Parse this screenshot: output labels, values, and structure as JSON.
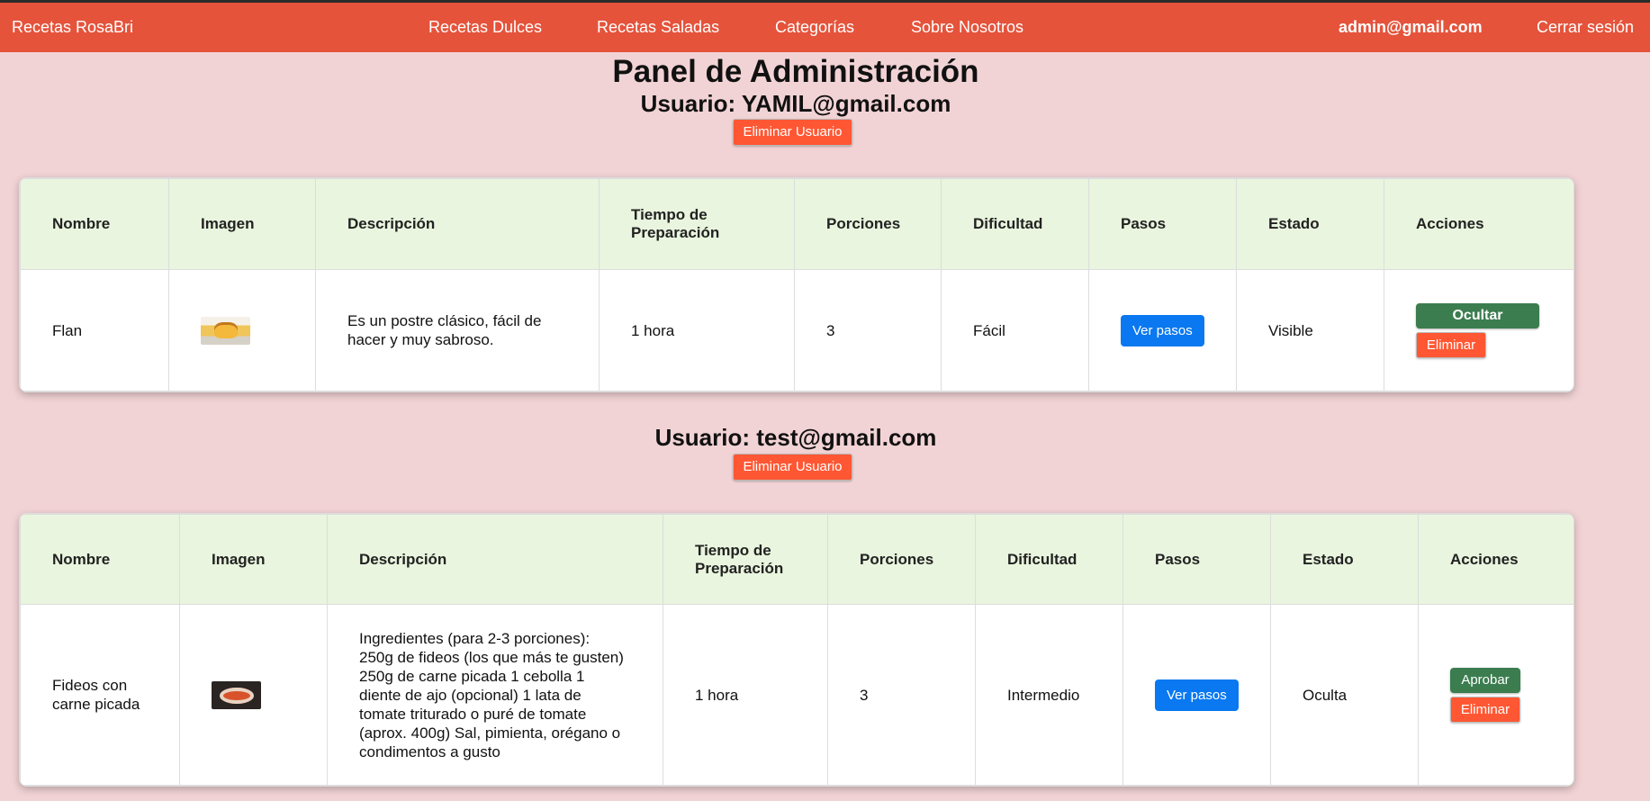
{
  "nav": {
    "brand": "Recetas RosaBri",
    "links": [
      "Recetas Dulces",
      "Recetas Saladas",
      "Categorías",
      "Sobre Nosotros"
    ],
    "user": "admin@gmail.com",
    "logout": "Cerrar sesión"
  },
  "page_title": "Panel de Administración",
  "headers": [
    "Nombre",
    "Imagen",
    "Descripción",
    "Tiempo de Preparación",
    "Porciones",
    "Dificultad",
    "Pasos",
    "Estado",
    "Acciones"
  ],
  "users": [
    {
      "title": "Usuario: YAMIL@gmail.com",
      "delete_label": "Eliminar Usuario",
      "recipe": {
        "nombre": "Flan",
        "image_icon": "flan-photo",
        "descripcion": "Es un postre clásico, fácil de hacer y muy sabroso.",
        "tiempo": "1 hora",
        "porciones": "3",
        "dificultad": "Fácil",
        "pasos_label": "Ver pasos",
        "estado": "Visible",
        "primary_action": "Ocultar",
        "delete_action": "Eliminar"
      }
    },
    {
      "title": "Usuario: test@gmail.com",
      "delete_label": "Eliminar Usuario",
      "recipe": {
        "nombre": "Fideos con carne picada",
        "image_icon": "fideos-photo",
        "descripcion": "Ingredientes (para 2-3 porciones): 250g de fideos (los que más te gusten) 250g de carne picada 1 cebolla 1 diente de ajo (opcional) 1 lata de tomate triturado o puré de tomate (aprox. 400g) Sal, pimienta, orégano o condimentos a gusto",
        "tiempo": "1 hora",
        "porciones": "3",
        "dificultad": "Intermedio",
        "pasos_label": "Ver pasos",
        "estado": "Oculta",
        "primary_action": "Aprobar",
        "delete_action": "Eliminar"
      }
    }
  ],
  "colors": {
    "navbar": "#e5533b",
    "background": "#f2d3d5",
    "header_row": "#e9f5de",
    "danger": "#ff5733",
    "primary": "#0a78f0",
    "success": "#3b7d4f"
  }
}
